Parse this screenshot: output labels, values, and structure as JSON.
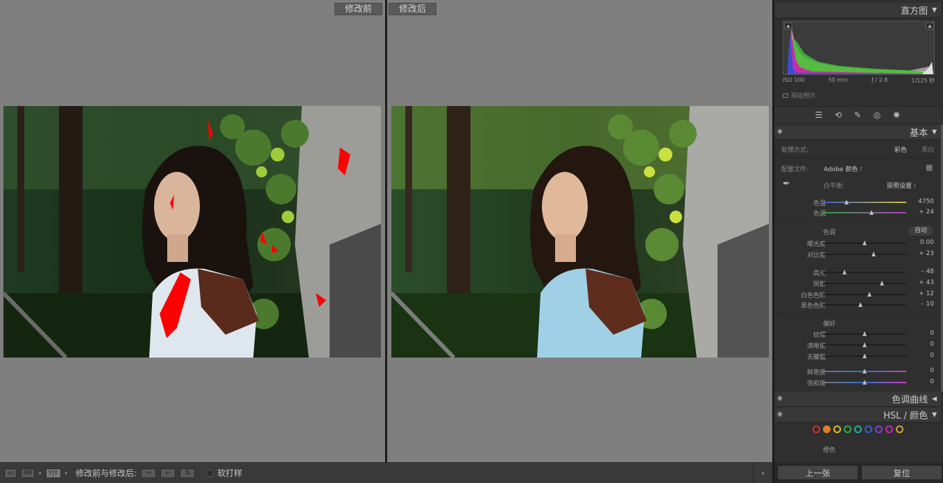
{
  "compare": {
    "before_label": "修改前",
    "after_label": "修改后"
  },
  "toolbar": {
    "compare_label": "修改前与修改后:",
    "softproof_label": "软打样",
    "yy_label": "Y|Y"
  },
  "histogram": {
    "title": "直方图",
    "iso": "ISO 100",
    "focal": "50 mm",
    "aperture": "ƒ / 2.8",
    "shutter": "1/125 秒",
    "original_photo": "原始照片"
  },
  "basic": {
    "title": "基本",
    "treatment_label": "处理方式:",
    "treatment_color": "彩色",
    "treatment_bw": "黑白",
    "profile_label": "配置文件:",
    "profile_value": "Adobe 颜色 ⁝",
    "wb_label": "白平衡:",
    "wb_value": "原照设置 ⁝",
    "temp_label": "色温",
    "temp_value": "4750",
    "temp_pos": 0.28,
    "tint_label": "色调",
    "tint_value": "+ 24",
    "tint_pos": 0.58,
    "tone_title": "色调",
    "tone_auto": "自动",
    "exposure_label": "曝光度",
    "exposure_value": "0.00",
    "exposure_pos": 0.5,
    "contrast_label": "对比度",
    "contrast_value": "+ 23",
    "contrast_pos": 0.61,
    "highlights_label": "高光",
    "highlights_value": "– 48",
    "highlights_pos": 0.26,
    "shadows_label": "阴影",
    "shadows_value": "+ 43",
    "shadows_pos": 0.71,
    "whites_label": "白色色阶",
    "whites_value": "+ 12",
    "whites_pos": 0.56,
    "blacks_label": "黑色色阶",
    "blacks_value": "– 10",
    "blacks_pos": 0.45,
    "presence_title": "偏好",
    "texture_label": "纹理",
    "texture_value": "0",
    "texture_pos": 0.5,
    "clarity_label": "清晰度",
    "clarity_value": "0",
    "clarity_pos": 0.5,
    "dehaze_label": "去朦胧",
    "dehaze_value": "0",
    "dehaze_pos": 0.5,
    "vibrance_label": "鲜艳度",
    "vibrance_value": "0",
    "vibrance_pos": 0.5,
    "saturation_label": "饱和度",
    "saturation_value": "0",
    "saturation_pos": 0.5
  },
  "tone_curve": {
    "title": "色调曲线"
  },
  "hsl": {
    "title": "HSL / 颜色",
    "sub_label": "橙色",
    "swatch_colors": [
      "#d03030",
      "#e08020",
      "#d8c020",
      "#30b040",
      "#20b0a0",
      "#3060d0",
      "#8040d0",
      "#c030b0"
    ]
  },
  "bottom": {
    "prev": "上一张",
    "reset": "复位"
  }
}
